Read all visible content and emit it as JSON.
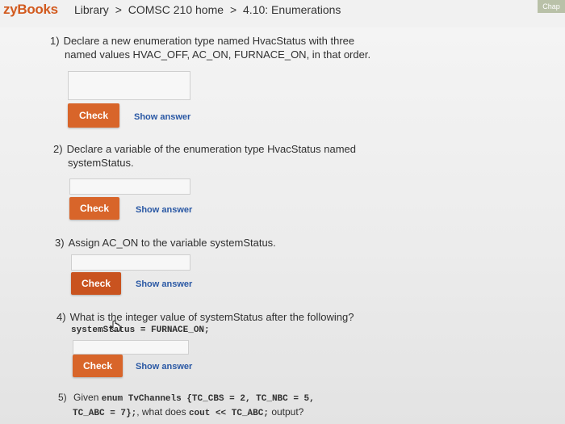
{
  "header": {
    "logo": "zyBooks",
    "breadcrumb": [
      "Library",
      ">",
      "COMSC 210 home",
      ">",
      "4.10: Enumerations"
    ],
    "corner_tab": "Chap"
  },
  "questions": [
    {
      "number": "1)",
      "text_line1": "Declare a new enumeration type named HvacStatus with three",
      "text_line2": "named values HVAC_OFF, AC_ON, FURNACE_ON, in that order.",
      "check_label": "Check",
      "show_answer_label": "Show answer"
    },
    {
      "number": "2)",
      "text_line1": "Declare a variable of the enumeration type HvacStatus named",
      "text_line2": "systemStatus.",
      "check_label": "Check",
      "show_answer_label": "Show answer"
    },
    {
      "number": "3)",
      "text_line1": "Assign AC_ON to the variable systemStatus.",
      "check_label": "Check",
      "show_answer_label": "Show answer"
    },
    {
      "number": "4)",
      "text_line1": "What is the integer value of systemStatus after the following?",
      "code": "systemStatus = FURNACE_ON;",
      "check_label": "Check",
      "show_answer_label": "Show answer"
    },
    {
      "number": "5)",
      "text_prefix": "Given",
      "code_a": "enum TvChannels {TC_CBS = 2, TC_NBC = 5,",
      "code_b": "TC_ABC = 7};",
      "text_mid": ", what does",
      "code_c": "cout << TC_ABC;",
      "text_suffix": "output?"
    }
  ],
  "colors": {
    "accent": "#d8652a",
    "link": "#2a58a4",
    "logo": "#d25a1e"
  }
}
